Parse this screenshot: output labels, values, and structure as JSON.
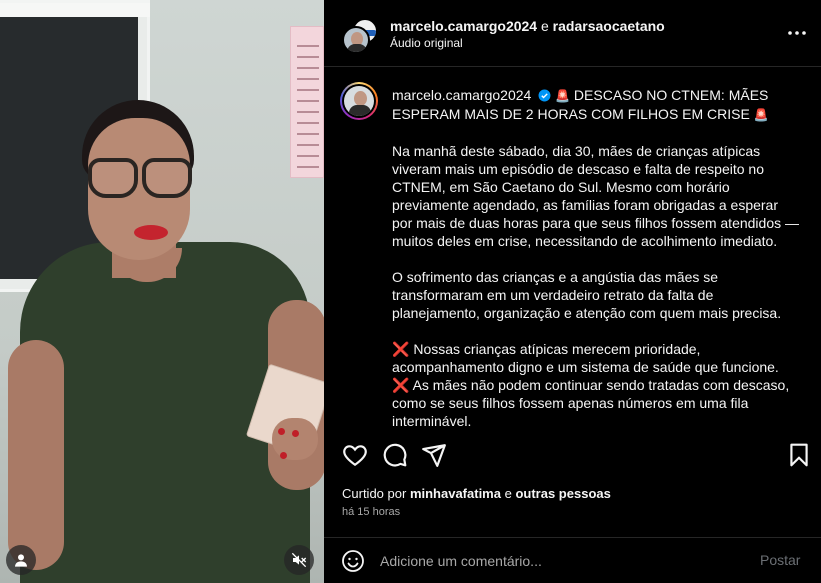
{
  "header": {
    "user1": "marcelo.camargo2024",
    "conjunction": "e",
    "user2": "radarsaocaetano",
    "audio": "Áudio original",
    "more_icon": "more-horizontal-icon"
  },
  "caption": {
    "username": "marcelo.camargo2024",
    "headline": "DESCASO NO CTNEM: MÃES ESPERAM MAIS DE 2 HORAS COM FILHOS EM CRISE",
    "siren": "🚨",
    "paragraph1": "Na manhã deste sábado, dia 30, mães de crianças atípicas viveram mais um episódio de descaso e falta de respeito no CTNEM, em São Caetano do Sul. Mesmo com horário previamente agendado, as famílias foram obrigadas a esperar por mais de duas horas para que seus filhos fossem atendidos — muitos deles em crise, necessitando de acolhimento imediato.",
    "paragraph2": "O sofrimento das crianças e a angústia das mães se transformaram em um verdadeiro retrato da falta de planejamento, organização e atenção com quem mais precisa.",
    "xmark": "❌",
    "point1": "Nossas crianças atípicas merecem prioridade, acompanhamento digno e um sistema de saúde que funcione.",
    "point2": "As mães não podem continuar sendo tratadas com descaso, como se seus filhos fossem apenas números em uma fila interminável."
  },
  "likes": {
    "prefix": "Curtido por",
    "user": "minhavafatima",
    "conjunction": "e",
    "others": "outras pessoas"
  },
  "time_ago": "há 15 horas",
  "comment": {
    "placeholder": "Adicione um comentário...",
    "post_label": "Postar"
  },
  "colors": {
    "background": "#000000",
    "text": "#f5f5f5",
    "muted": "#a8a8a8",
    "verified": "#0095f6",
    "post_disabled": "#6b6f74"
  }
}
